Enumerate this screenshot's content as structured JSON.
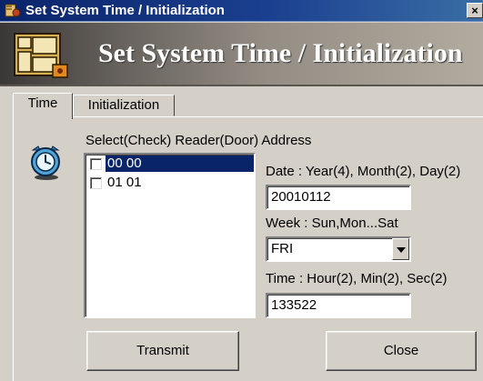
{
  "window": {
    "title": "Set System Time / Initialization",
    "close_label": "×"
  },
  "banner": {
    "title": "Set System Time / Initialization"
  },
  "tabs": [
    {
      "label": "Time"
    },
    {
      "label": "Initialization"
    }
  ],
  "reader_list": {
    "label": "Select(Check) Reader(Door) Address",
    "items": [
      {
        "label": "00 00",
        "checked": false,
        "selected": true
      },
      {
        "label": "01 01",
        "checked": false,
        "selected": false
      }
    ]
  },
  "date": {
    "label": "Date : Year(4), Month(2), Day(2)",
    "value": "20010112"
  },
  "week": {
    "label": "Week : Sun,Mon...Sat",
    "value": "FRI"
  },
  "time": {
    "label": "Time : Hour(2), Min(2), Sec(2)",
    "value": "133522"
  },
  "buttons": {
    "transmit": "Transmit",
    "close": "Close"
  },
  "colors": {
    "titlebar": "#0a246a",
    "selection": "#0a246a",
    "face": "#d4d0c8"
  },
  "icons": {
    "app": "app-icon",
    "logo": "window-logo-icon",
    "clock": "clock-icon",
    "dropdown": "chevron-down-icon"
  }
}
